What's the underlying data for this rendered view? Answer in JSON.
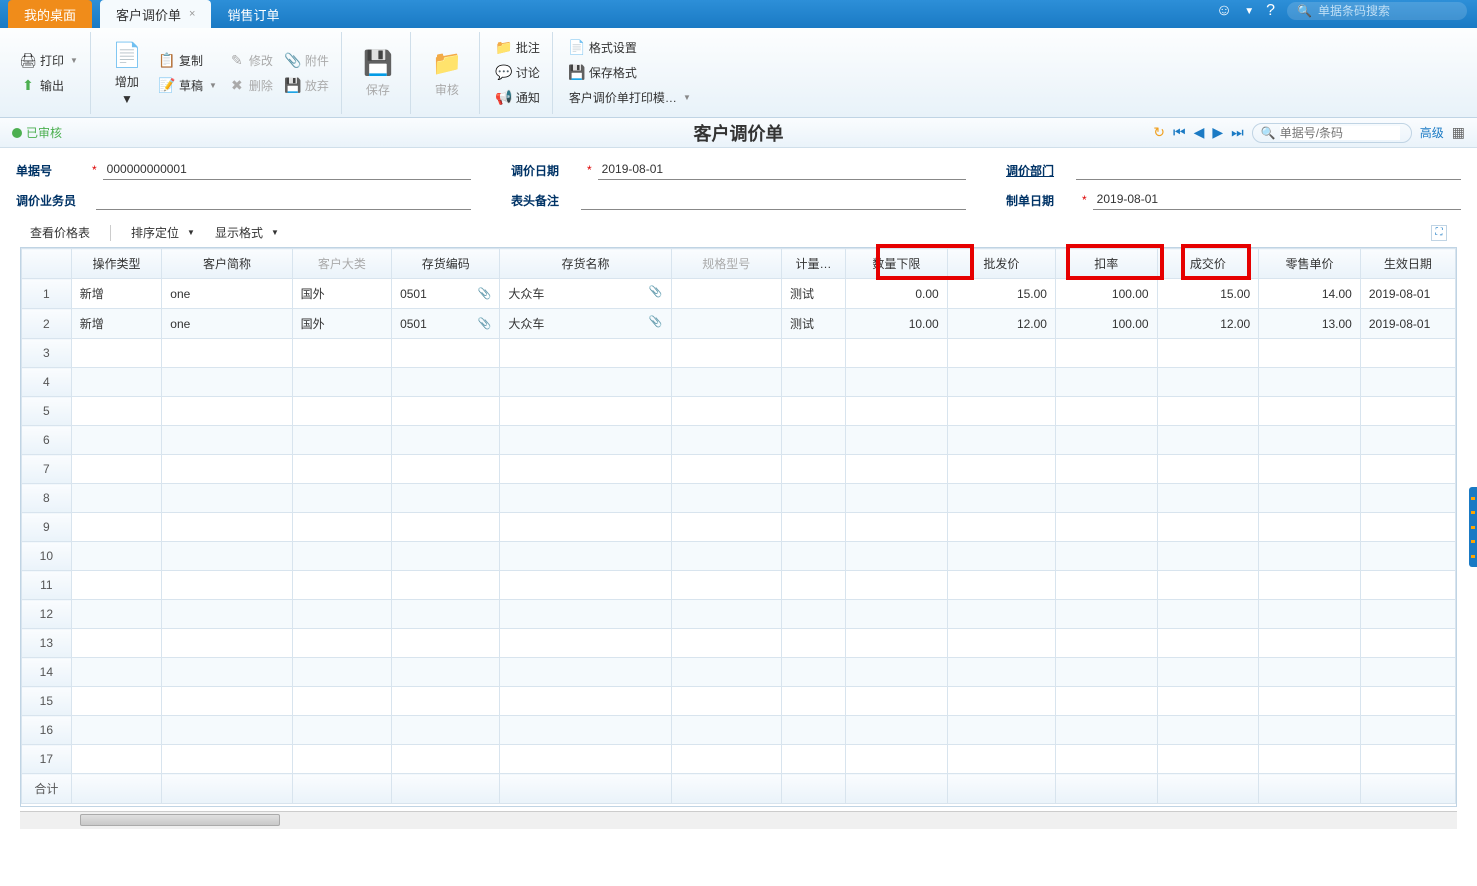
{
  "tabs": {
    "desktop": "我的桌面",
    "active": "客户调价单",
    "other": "销售订单"
  },
  "topSearch": {
    "placeholder": "单据条码搜索"
  },
  "toolbar": {
    "print": "打印",
    "export": "输出",
    "add": "增加",
    "copy": "复制",
    "modify": "修改",
    "attach": "附件",
    "draft": "草稿",
    "delete": "删除",
    "abandon": "放弃",
    "save": "保存",
    "audit": "审核",
    "note": "批注",
    "discuss": "讨论",
    "notify": "通知",
    "format": "格式设置",
    "saveFormat": "保存格式",
    "printTpl": "客户调价单打印模…"
  },
  "status": "已审核",
  "pageTitle": "客户调价单",
  "navSearch": {
    "placeholder": "单据号/条码"
  },
  "advanced": "高级",
  "form": {
    "billNo": {
      "label": "单据号",
      "value": "000000000001"
    },
    "adjustDate": {
      "label": "调价日期",
      "value": "2019-08-01"
    },
    "dept": {
      "label": "调价部门",
      "value": ""
    },
    "salesperson": {
      "label": "调价业务员",
      "value": ""
    },
    "remark": {
      "label": "表头备注",
      "value": ""
    },
    "createDate": {
      "label": "制单日期",
      "value": "2019-08-01"
    }
  },
  "tableToolbar": {
    "viewPrice": "查看价格表",
    "sort": "排序定位",
    "display": "显示格式"
  },
  "columns": {
    "op": "操作类型",
    "custShort": "客户简称",
    "custCat": "客户大类",
    "invCode": "存货编码",
    "invName": "存货名称",
    "spec": "规格型号",
    "unit": "计量…",
    "qtyMin": "数量下限",
    "wholesale": "批发价",
    "discount": "扣率",
    "deal": "成交价",
    "retail": "零售单价",
    "effDate": "生效日期"
  },
  "rows": [
    {
      "op": "新增",
      "custShort": "one",
      "custCat": "国外",
      "invCode": "0501",
      "invName": "大众车",
      "spec": "",
      "unit": "测试",
      "qtyMin": "0.00",
      "wholesale": "15.00",
      "discount": "100.00",
      "deal": "15.00",
      "retail": "14.00",
      "effDate": "2019-08-01"
    },
    {
      "op": "新增",
      "custShort": "one",
      "custCat": "国外",
      "invCode": "0501",
      "invName": "大众车",
      "spec": "",
      "unit": "测试",
      "qtyMin": "10.00",
      "wholesale": "12.00",
      "discount": "100.00",
      "deal": "12.00",
      "retail": "13.00",
      "effDate": "2019-08-01"
    }
  ],
  "totalLabel": "合计",
  "emptyRows": 15
}
